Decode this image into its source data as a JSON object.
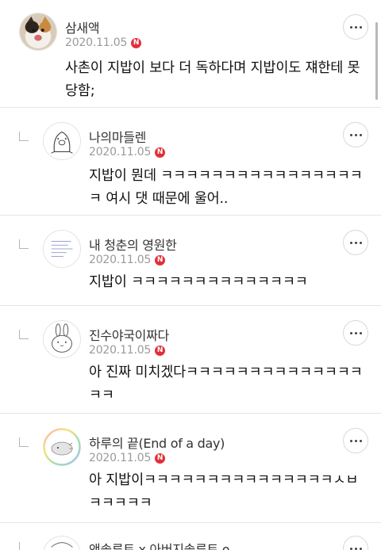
{
  "comments": [
    {
      "name": "삼새액",
      "date": "2020.11.05",
      "badge": "N",
      "text": "사촌이 지밥이 보다 더 독하다며 지밥이도 쟤한테 못당함;",
      "avatar": "cat-photo",
      "reply": false
    },
    {
      "name": "나의마들렌",
      "date": "2020.11.05",
      "badge": "N",
      "text": "지밥이 뭔데 ㅋㅋㅋㅋㅋㅋㅋㅋㅋㅋㅋㅋㅋㅋㅋㅋㅋ 여시 댓 때문에 울어..",
      "avatar": "pig-doodle",
      "reply": true
    },
    {
      "name": "내 청춘의 영원한",
      "date": "2020.11.05",
      "badge": "N",
      "text": "지밥이 ㅋㅋㅋㅋㅋㅋㅋㅋㅋㅋㅋㅋㅋㅋ",
      "avatar": "handwriting-note",
      "reply": true
    },
    {
      "name": "진수야국이짜다",
      "date": "2020.11.05",
      "badge": "N",
      "text": "아 진짜 미치겠다ㅋㅋㅋㅋㅋㅋㅋㅋㅋㅋㅋㅋㅋㅋㅋㅋ",
      "avatar": "rabbit-doodle",
      "reply": true
    },
    {
      "name": "하루의 끝(End of a day)",
      "date": "2020.11.05",
      "badge": "N",
      "text": "아 지밥이ㅋㅋㅋㅋㅋㅋㅋㅋㅋㅋㅋㅋㅋㅋㅋㅅㅂㅋㅋㅋㅋㅋ",
      "avatar": "rainbow-ring-doodle",
      "reply": true
    },
    {
      "name": "앤솔루트 x 아버지솔루트 o",
      "date": "",
      "badge": "",
      "text": "",
      "avatar": "partial-doodle",
      "reply": true
    }
  ],
  "icons": {
    "more": "more-options-icon",
    "reply": "reply-arrow-icon"
  },
  "colors": {
    "badge": "#e1303a",
    "date": "#9a9a9a",
    "divider": "#e6e6e6"
  }
}
